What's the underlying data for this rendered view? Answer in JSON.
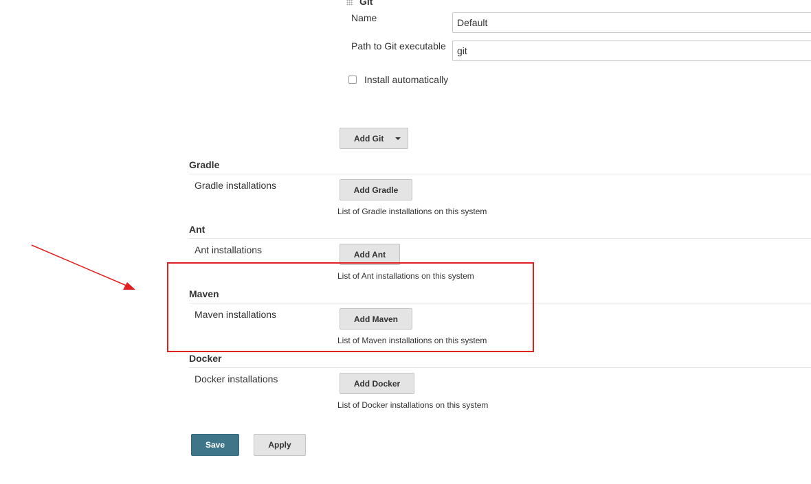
{
  "git": {
    "title": "Git",
    "name_label": "Name",
    "name_value": "Default",
    "path_label": "Path to Git executable",
    "path_value": "git",
    "install_auto_label": "Install automatically",
    "add_button": "Add Git"
  },
  "sections": {
    "gradle": {
      "title": "Gradle",
      "label": "Gradle installations",
      "button": "Add Gradle",
      "help": "List of Gradle installations on this system"
    },
    "ant": {
      "title": "Ant",
      "label": "Ant installations",
      "button": "Add Ant",
      "help": "List of Ant installations on this system"
    },
    "maven": {
      "title": "Maven",
      "label": "Maven installations",
      "button": "Add Maven",
      "help": "List of Maven installations on this system"
    },
    "docker": {
      "title": "Docker",
      "label": "Docker installations",
      "button": "Add Docker",
      "help": "List of Docker installations on this system"
    }
  },
  "actions": {
    "save": "Save",
    "apply": "Apply"
  },
  "colors": {
    "primary": "#3f7589",
    "annotation": "#e02020"
  }
}
